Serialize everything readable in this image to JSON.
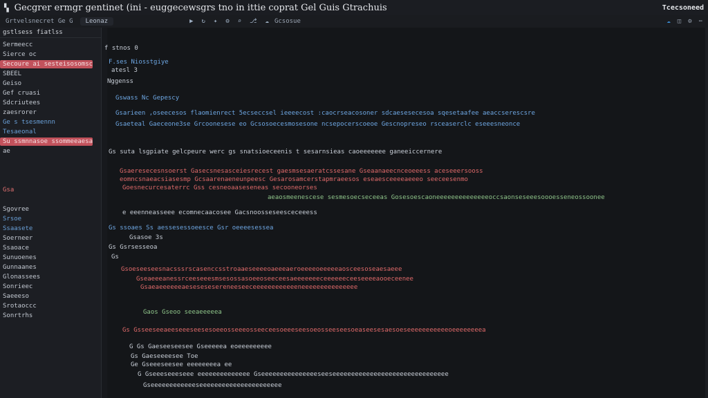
{
  "titlebar": {
    "title": "Gecgrer ermgr gentinet  (ini - euggecewsgrs  tno in  ittie  coprat Gel Guis  Gtrachuis",
    "right": "Tcecsoneed",
    "icon": "app-icon"
  },
  "toolbar": {
    "left": "Grtvelsnecret   Ge  G",
    "file_tab": "Leonaz",
    "icon_names": [
      "play-icon",
      "refresh-icon",
      "bug-icon",
      "settings-icon",
      "search-icon",
      "branch-icon",
      "cloud-icon"
    ],
    "tail": "Gcsosue",
    "right_icons": [
      "cloud-icon",
      "split-icon",
      "gear-icon",
      "more-icon"
    ]
  },
  "sidebar": {
    "header": "gstlsess  fiatlss",
    "items": [
      {
        "label": "Sermeecc",
        "color": "fg"
      },
      {
        "label": "Sierce oc",
        "color": "fg"
      },
      {
        "label": "Secoure  ai  sesteisosomsc",
        "color": "fg",
        "highlight": true
      },
      {
        "label": "SBEEL",
        "color": "fg"
      },
      {
        "label": "Geiso",
        "color": "fg"
      },
      {
        "label": "Gef  cruasi",
        "color": "fg"
      },
      {
        "label": "Sdcriutees",
        "color": "fg"
      },
      {
        "label": "zaesrorer",
        "color": "fg"
      },
      {
        "label": "Ge  s tsesmennn",
        "color": "blue"
      },
      {
        "label": "Tesaeonal",
        "color": "blue"
      },
      {
        "label": "Su  ssmnnasoe  ssommeeaesa",
        "color": "fg",
        "highlight": true
      },
      {
        "label": "ae",
        "color": "fg"
      },
      {
        "label": "",
        "color": "fg"
      },
      {
        "label": "",
        "color": "fg"
      },
      {
        "label": "",
        "color": "fg"
      },
      {
        "label": "Gsa",
        "color": "red"
      },
      {
        "label": "",
        "color": "fg"
      },
      {
        "label": "Sgovree",
        "color": "fg"
      },
      {
        "label": "Srsoe",
        "color": "blue"
      },
      {
        "label": "Ssaasete",
        "color": "blue"
      },
      {
        "label": "Soerneer",
        "color": "fg"
      },
      {
        "label": "Ssaoace",
        "color": "fg"
      },
      {
        "label": "Sunuoenes",
        "color": "fg"
      },
      {
        "label": "Gunnaanes",
        "color": "fg"
      },
      {
        "label": "Glonassees",
        "color": "fg"
      },
      {
        "label": "Sonrieec",
        "color": "fg"
      },
      {
        "label": "Saeeeso",
        "color": "fg"
      },
      {
        "label": "Srotaoccc",
        "color": "fg"
      },
      {
        "label": "Sonrtrhs",
        "color": "fg"
      }
    ]
  },
  "editor": {
    "lines": [
      {
        "text": "f stnos   0",
        "color": "fg"
      },
      {
        "text": "  F.ses   Niosstgiye",
        "color": "blue"
      },
      {
        "text": "  atesl    3",
        "color": "fg"
      },
      {
        "text": "  Nggenss",
        "color": "fg"
      },
      {
        "text": "    Gswass   Nc  Gepescy",
        "color": "blue"
      },
      {
        "text": "    Gsarieen   ,oseecesos    flaomienrect   5ecseccsel   ieeeecost  :caocrseacosoner  sdcaesesecesoa  sqesetaafee   aeaccserescsre",
        "color": "blue"
      },
      {
        "text": "    Gsaeteal  Gaeceone3se   Grcoonesese   eo  Gcsosoecesmosesone  ncsepocerscoeoe  Gescnopreseo  rsceaserclc  eseeesneonce",
        "color": "blue"
      },
      {
        "text": "  Gs  suta    lsgpiate  gelcpeure  werc  gs  snatsioeceenis  t  sesarnsieas   caoeeeeeee   ganeeiccernere",
        "color": "fg"
      },
      {
        "text": "    Gsaeresecesnsoerst  Gasecsnesasceiesrecest  gaesmsesaeratcssesane  Gseaanaeecnceoeeess   aceseeersooss",
        "color": "red"
      },
      {
        "text": "    eomncsnaeacsiasesmp  Gcsaarenaeneunpeesc  Gesarosamcerstapmraeesos  eseaesceeeeaeeeo  seeceesenmo",
        "color": "red"
      },
      {
        "text": "    Goesnecurcesaterrc  Gss  cesneoaaseseneas  secooneorses",
        "color": "red"
      },
      {
        "text": "                 aeaosmeenescese  sesmesoecseceeas   Gosesoescaoneeeeeeeeeeeeeeoccsaonseseeesoooesseneossoonee",
        "color": "green"
      },
      {
        "text": "    e  eeenneasseee  ecomnecaacosee  Gacsnoosseseesceceeess",
        "color": "fg"
      },
      {
        "text": "  Gs  ssoaes  Ss  aessesessoeesce  Gsr  oeeeesessea",
        "color": "blue"
      },
      {
        "text": "      Gsasoe   3s",
        "color": "fg"
      },
      {
        "text": "  Gs   Gsrsesseoa",
        "color": "fg"
      },
      {
        "text": "   Gs",
        "color": "fg"
      },
      {
        "text": "    Gsoeseeseesnacsssrscasenccsstroaaeseeeeoaeeeaeroeeeeoeeeeeaosceesoseaesaeee",
        "color": "red"
      },
      {
        "text": "      Gseaeeeanessrceeseeesmsesossasoeeoseeceesaeeeeeeeceeeeeeceeseeeeaooeceenee",
        "color": "red"
      },
      {
        "text": "        Gsaeaeeeeeeaesesesesereneeseeceeeeeeeeeeeeneeeeeeeeeeeeeee",
        "color": "red"
      },
      {
        "text": "  ",
        "color": "fg"
      },
      {
        "text": "      Gaos   Gseoo  seeaeeeeea",
        "color": "green"
      },
      {
        "text": "  ",
        "color": "fg"
      },
      {
        "text": "  Gs  Gsseeseeaeeseeeseesesoeeosseeeosseeceesoeeeseesoeosseeseesoeaseesesaesoeseeeeeeeeeeeoeeeeeeeea",
        "color": "red"
      },
      {
        "text": "  ",
        "color": "fg"
      },
      {
        "text": "      G  Gs  Gaeseeseesee  Gseeeeea  eoeeeeeeeee",
        "color": "fg"
      },
      {
        "text": "      Gs   Gaeseeeesee  Toe",
        "color": "fg"
      },
      {
        "text": "      Ge  Gseeeseesee  eeeeeeeea  ee",
        "color": "fg"
      },
      {
        "text": "        G  Gseeeseeeseee  eeeeeeeeeeeeee   Gseeeeeeeeeeeeeeeseeseeeeeeeeeeeeeeeeeeeeeeeeeeeeeee",
        "color": "fg"
      },
      {
        "text": "        Gseeeeeeeeeeeeseeeeeeeeeeeeeeeeeeeeee",
        "color": "fg"
      }
    ]
  }
}
